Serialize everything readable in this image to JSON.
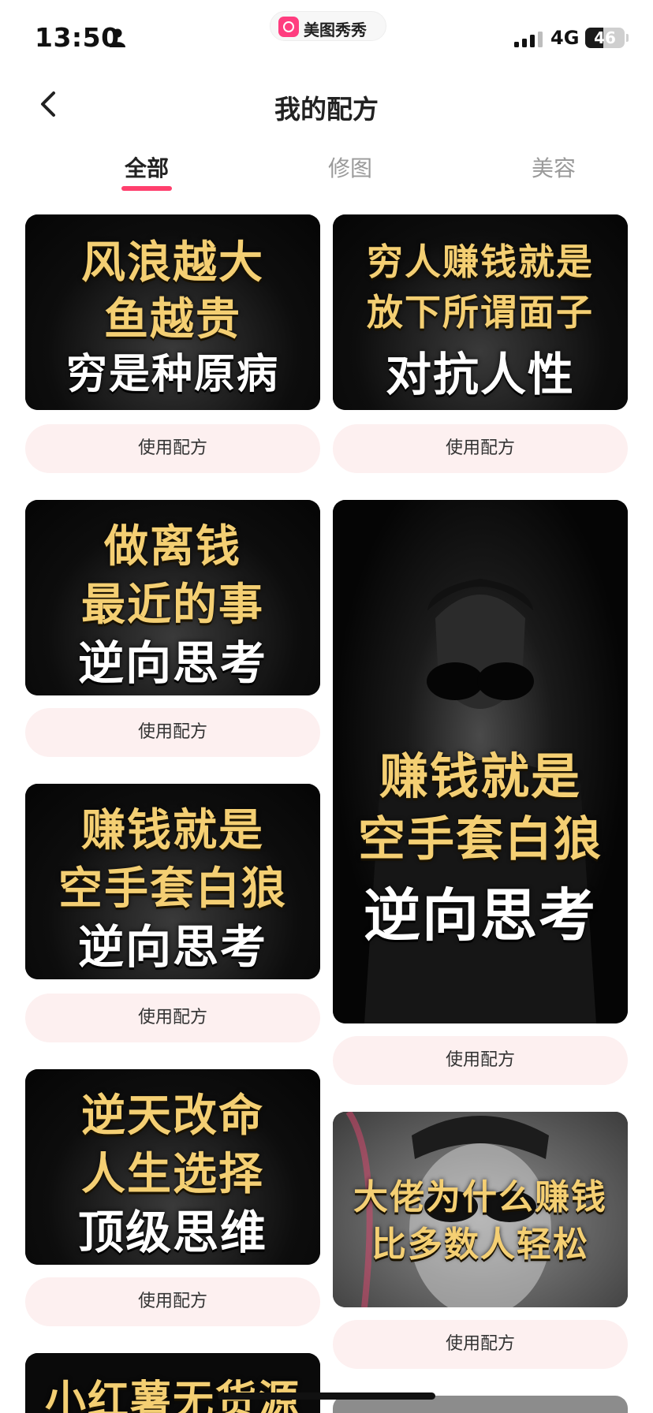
{
  "status_bar": {
    "time": "13:50",
    "app_pill_label": "美图秀秀",
    "network": "4G",
    "battery_level": "46",
    "battery_fraction": 0.46
  },
  "header": {
    "title": "我的配方",
    "back_icon": "chevron-left-icon"
  },
  "tabs": [
    {
      "label": "全部",
      "active": true
    },
    {
      "label": "修图",
      "active": false
    },
    {
      "label": "美容",
      "active": false
    }
  ],
  "colors": {
    "accent": "#ff3f6d",
    "button_bg": "#fdf0f0",
    "gold_text": "#f4cf73"
  },
  "cards": [
    {
      "lines": [
        "风浪越大",
        "鱼越贵",
        "穷是种原病"
      ],
      "button": "使用配方"
    },
    {
      "lines": [
        "穷人赚钱就是",
        "放下所谓面子",
        "对抗人性"
      ],
      "button": "使用配方"
    },
    {
      "lines": [
        "做离钱",
        "最近的事",
        "逆向思考"
      ],
      "button": "使用配方"
    },
    {
      "lines": [
        "赚钱就是",
        "空手套白狼",
        "逆向思考"
      ],
      "button": "使用配方"
    },
    {
      "lines": [
        "赚钱就是",
        "空手套白狼",
        "逆向思考"
      ],
      "button": "使用配方"
    },
    {
      "lines": [
        "逆天改命",
        "人生选择",
        "顶级思维"
      ],
      "button": "使用配方"
    },
    {
      "lines": [
        "大佬为什么赚钱",
        "比多数人轻松"
      ],
      "button": "使用配方"
    },
    {
      "lines": [
        "小红薯无货源"
      ]
    }
  ]
}
